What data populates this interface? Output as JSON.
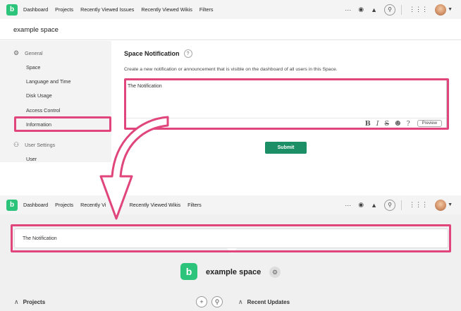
{
  "nav": {
    "logo_letter": "b",
    "links": [
      "Dashboard",
      "Projects",
      "Recently Viewed Issues",
      "Recently Viewed Wikis",
      "Filters"
    ],
    "links_lower": [
      "Dashboard",
      "Projects",
      "Recently Vi",
      "sues",
      "Recently Viewed Wikis",
      "Filters"
    ],
    "more": "···"
  },
  "space": {
    "title": "example space"
  },
  "sidebar": {
    "general_heading": "General",
    "items": [
      "Space",
      "Language and Time",
      "Disk Usage",
      "Access Control",
      "Information"
    ],
    "user_settings_heading": "User Settings",
    "user_item": "User"
  },
  "form": {
    "title": "Space Notification",
    "help": "?",
    "description": "Create a new notification or announcement that is visible on the dashboard of all users in this Space.",
    "value": "The Notification",
    "format_buttons": [
      "B",
      "I",
      "S",
      "☻",
      "?"
    ],
    "preview_label": "Preview",
    "submit_label": "Submit"
  },
  "dashboard": {
    "notification_text": "The Notification",
    "space_name": "example space",
    "projects_label": "Projects",
    "recent_updates_label": "Recent Updates"
  },
  "colors": {
    "brand_green": "#2cc47a",
    "submit_green": "#1d8f67",
    "highlight_pink": "#e0457b"
  }
}
